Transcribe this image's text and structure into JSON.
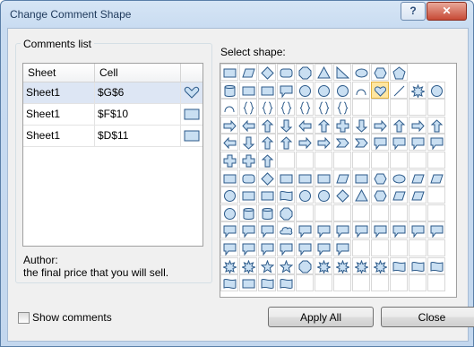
{
  "window": {
    "title": "Change Comment Shape",
    "help_label": "?",
    "close_label": "✕"
  },
  "comments": {
    "group_label": "Comments list",
    "columns": [
      "Sheet",
      "Cell"
    ],
    "rows": [
      {
        "sheet": "Sheet1",
        "cell": "$G$6",
        "shape": "heart-shape-icon",
        "selected": true
      },
      {
        "sheet": "Sheet1",
        "cell": "$F$10",
        "shape": "rectangle-shape-icon",
        "selected": false
      },
      {
        "sheet": "Sheet1",
        "cell": "$D$11",
        "shape": "rectangle-shape-icon",
        "selected": false
      }
    ]
  },
  "author": {
    "label": "Author:",
    "text": "the final price that you will sell."
  },
  "shapes": {
    "label": "Select shape:",
    "selected_icon": "heart-shape-icon"
  },
  "footer": {
    "show_comments_label": "Show comments",
    "show_comments_checked": false,
    "apply_all_label": "Apply All",
    "close_label": "Close"
  },
  "colors": {
    "shape_fill": "#c9dff2",
    "shape_stroke": "#2c5a8a",
    "selected_tile": "#ffe6a0",
    "title_text": "#1e395b"
  }
}
